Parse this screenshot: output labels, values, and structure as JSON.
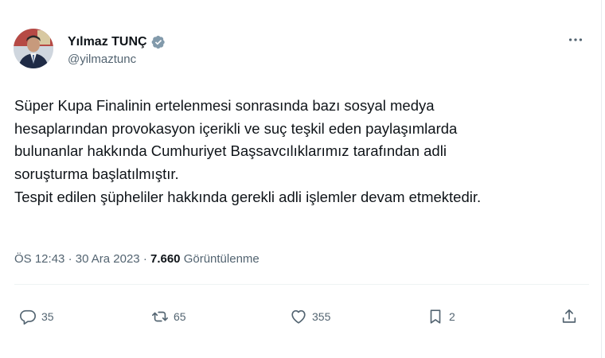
{
  "author": {
    "display_name": "Yılmaz TUNÇ",
    "handle": "@yilmaztunc",
    "verified_color": "#829aab"
  },
  "post": {
    "lines": [
      "Süper Kupa Finalinin ertelenmesi sonrasında bazı sosyal medya",
      "hesaplarından provokasyon içerikli ve suç teşkil eden paylaşımlarda",
      "bulunanlar hakkında Cumhuriyet Başsavcılıklarımız tarafından adli",
      "soruşturma başlatılmıştır.",
      "Tespit edilen şüpheliler hakkında gerekli adli işlemler devam etmektedir."
    ],
    "time": "ÖS 12:43",
    "separator": "·",
    "date": "30 Ara 2023",
    "views_count": "7.660",
    "views_label": "Görüntülenme"
  },
  "actions": {
    "replies": "35",
    "reposts": "65",
    "likes": "355",
    "bookmarks": "2"
  },
  "icons": {
    "more": "more-horizontal-icon",
    "reply": "reply-icon",
    "repost": "repost-icon",
    "like": "heart-icon",
    "bookmark": "bookmark-icon",
    "share": "share-icon"
  }
}
